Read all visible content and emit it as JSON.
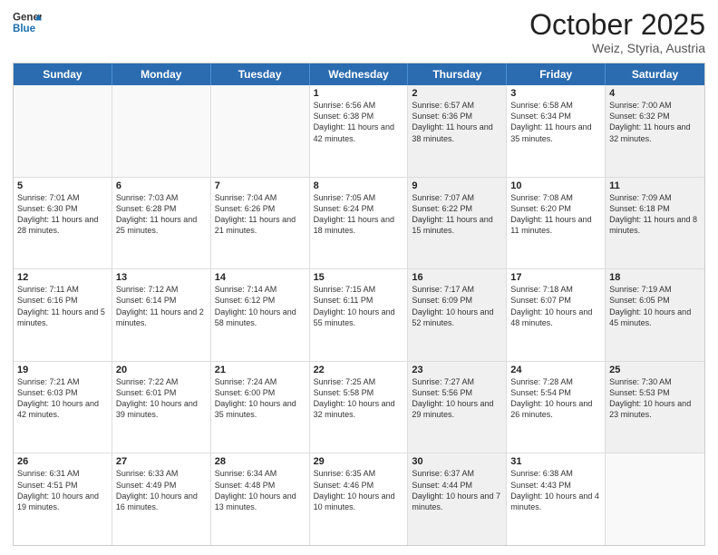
{
  "logo": {
    "general": "General",
    "blue": "Blue"
  },
  "title": {
    "month": "October 2025",
    "location": "Weiz, Styria, Austria"
  },
  "header_days": [
    "Sunday",
    "Monday",
    "Tuesday",
    "Wednesday",
    "Thursday",
    "Friday",
    "Saturday"
  ],
  "weeks": [
    [
      {
        "day": "",
        "info": "",
        "shaded": false,
        "empty": true
      },
      {
        "day": "",
        "info": "",
        "shaded": false,
        "empty": true
      },
      {
        "day": "",
        "info": "",
        "shaded": false,
        "empty": true
      },
      {
        "day": "1",
        "info": "Sunrise: 6:56 AM\nSunset: 6:38 PM\nDaylight: 11 hours\nand 42 minutes.",
        "shaded": false,
        "empty": false
      },
      {
        "day": "2",
        "info": "Sunrise: 6:57 AM\nSunset: 6:36 PM\nDaylight: 11 hours\nand 38 minutes.",
        "shaded": true,
        "empty": false
      },
      {
        "day": "3",
        "info": "Sunrise: 6:58 AM\nSunset: 6:34 PM\nDaylight: 11 hours\nand 35 minutes.",
        "shaded": false,
        "empty": false
      },
      {
        "day": "4",
        "info": "Sunrise: 7:00 AM\nSunset: 6:32 PM\nDaylight: 11 hours\nand 32 minutes.",
        "shaded": true,
        "empty": false
      }
    ],
    [
      {
        "day": "5",
        "info": "Sunrise: 7:01 AM\nSunset: 6:30 PM\nDaylight: 11 hours\nand 28 minutes.",
        "shaded": false,
        "empty": false
      },
      {
        "day": "6",
        "info": "Sunrise: 7:03 AM\nSunset: 6:28 PM\nDaylight: 11 hours\nand 25 minutes.",
        "shaded": false,
        "empty": false
      },
      {
        "day": "7",
        "info": "Sunrise: 7:04 AM\nSunset: 6:26 PM\nDaylight: 11 hours\nand 21 minutes.",
        "shaded": false,
        "empty": false
      },
      {
        "day": "8",
        "info": "Sunrise: 7:05 AM\nSunset: 6:24 PM\nDaylight: 11 hours\nand 18 minutes.",
        "shaded": false,
        "empty": false
      },
      {
        "day": "9",
        "info": "Sunrise: 7:07 AM\nSunset: 6:22 PM\nDaylight: 11 hours\nand 15 minutes.",
        "shaded": true,
        "empty": false
      },
      {
        "day": "10",
        "info": "Sunrise: 7:08 AM\nSunset: 6:20 PM\nDaylight: 11 hours\nand 11 minutes.",
        "shaded": false,
        "empty": false
      },
      {
        "day": "11",
        "info": "Sunrise: 7:09 AM\nSunset: 6:18 PM\nDaylight: 11 hours\nand 8 minutes.",
        "shaded": true,
        "empty": false
      }
    ],
    [
      {
        "day": "12",
        "info": "Sunrise: 7:11 AM\nSunset: 6:16 PM\nDaylight: 11 hours\nand 5 minutes.",
        "shaded": false,
        "empty": false
      },
      {
        "day": "13",
        "info": "Sunrise: 7:12 AM\nSunset: 6:14 PM\nDaylight: 11 hours\nand 2 minutes.",
        "shaded": false,
        "empty": false
      },
      {
        "day": "14",
        "info": "Sunrise: 7:14 AM\nSunset: 6:12 PM\nDaylight: 10 hours\nand 58 minutes.",
        "shaded": false,
        "empty": false
      },
      {
        "day": "15",
        "info": "Sunrise: 7:15 AM\nSunset: 6:11 PM\nDaylight: 10 hours\nand 55 minutes.",
        "shaded": false,
        "empty": false
      },
      {
        "day": "16",
        "info": "Sunrise: 7:17 AM\nSunset: 6:09 PM\nDaylight: 10 hours\nand 52 minutes.",
        "shaded": true,
        "empty": false
      },
      {
        "day": "17",
        "info": "Sunrise: 7:18 AM\nSunset: 6:07 PM\nDaylight: 10 hours\nand 48 minutes.",
        "shaded": false,
        "empty": false
      },
      {
        "day": "18",
        "info": "Sunrise: 7:19 AM\nSunset: 6:05 PM\nDaylight: 10 hours\nand 45 minutes.",
        "shaded": true,
        "empty": false
      }
    ],
    [
      {
        "day": "19",
        "info": "Sunrise: 7:21 AM\nSunset: 6:03 PM\nDaylight: 10 hours\nand 42 minutes.",
        "shaded": false,
        "empty": false
      },
      {
        "day": "20",
        "info": "Sunrise: 7:22 AM\nSunset: 6:01 PM\nDaylight: 10 hours\nand 39 minutes.",
        "shaded": false,
        "empty": false
      },
      {
        "day": "21",
        "info": "Sunrise: 7:24 AM\nSunset: 6:00 PM\nDaylight: 10 hours\nand 35 minutes.",
        "shaded": false,
        "empty": false
      },
      {
        "day": "22",
        "info": "Sunrise: 7:25 AM\nSunset: 5:58 PM\nDaylight: 10 hours\nand 32 minutes.",
        "shaded": false,
        "empty": false
      },
      {
        "day": "23",
        "info": "Sunrise: 7:27 AM\nSunset: 5:56 PM\nDaylight: 10 hours\nand 29 minutes.",
        "shaded": true,
        "empty": false
      },
      {
        "day": "24",
        "info": "Sunrise: 7:28 AM\nSunset: 5:54 PM\nDaylight: 10 hours\nand 26 minutes.",
        "shaded": false,
        "empty": false
      },
      {
        "day": "25",
        "info": "Sunrise: 7:30 AM\nSunset: 5:53 PM\nDaylight: 10 hours\nand 23 minutes.",
        "shaded": true,
        "empty": false
      }
    ],
    [
      {
        "day": "26",
        "info": "Sunrise: 6:31 AM\nSunset: 4:51 PM\nDaylight: 10 hours\nand 19 minutes.",
        "shaded": false,
        "empty": false
      },
      {
        "day": "27",
        "info": "Sunrise: 6:33 AM\nSunset: 4:49 PM\nDaylight: 10 hours\nand 16 minutes.",
        "shaded": false,
        "empty": false
      },
      {
        "day": "28",
        "info": "Sunrise: 6:34 AM\nSunset: 4:48 PM\nDaylight: 10 hours\nand 13 minutes.",
        "shaded": false,
        "empty": false
      },
      {
        "day": "29",
        "info": "Sunrise: 6:35 AM\nSunset: 4:46 PM\nDaylight: 10 hours\nand 10 minutes.",
        "shaded": false,
        "empty": false
      },
      {
        "day": "30",
        "info": "Sunrise: 6:37 AM\nSunset: 4:44 PM\nDaylight: 10 hours\nand 7 minutes.",
        "shaded": true,
        "empty": false
      },
      {
        "day": "31",
        "info": "Sunrise: 6:38 AM\nSunset: 4:43 PM\nDaylight: 10 hours\nand 4 minutes.",
        "shaded": false,
        "empty": false
      },
      {
        "day": "",
        "info": "",
        "shaded": true,
        "empty": true
      }
    ]
  ]
}
